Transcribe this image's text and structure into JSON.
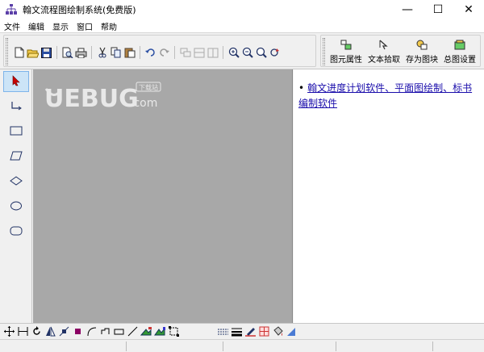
{
  "window": {
    "title": "翰文流程图绘制系统(免费版)",
    "minimize": "—",
    "maximize": "☐",
    "close": "✕"
  },
  "menu": [
    "文件",
    "编辑",
    "显示",
    "窗口",
    "帮助"
  ],
  "toolbar": {
    "big_buttons": [
      {
        "label": "图元属性",
        "icon": "shape-properties-icon"
      },
      {
        "label": "文本拾取",
        "icon": "text-pick-icon"
      },
      {
        "label": "存为图块",
        "icon": "save-block-icon"
      },
      {
        "label": "总图设置",
        "icon": "drawing-settings-icon"
      }
    ]
  },
  "watermark": {
    "text": "UEBUG",
    "suffix": ".com",
    "badge": "下载站"
  },
  "right_panel": {
    "link_text": "翰文进度计划软件、平面图绘制、标书编制软件"
  },
  "colors": {
    "canvas": "#a8a8a8",
    "link": "#1a0dab",
    "selection": "#cce4f7"
  }
}
